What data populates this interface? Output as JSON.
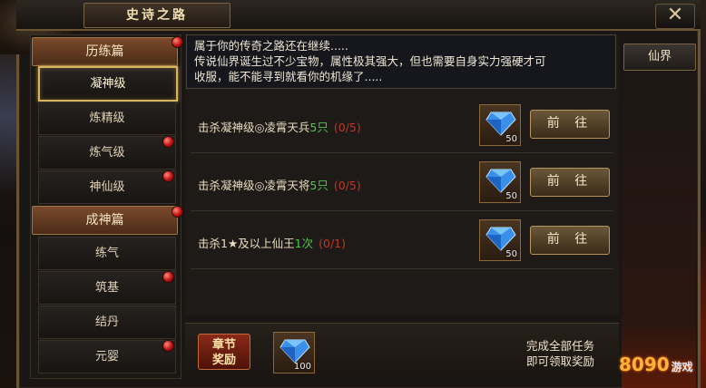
{
  "window": {
    "title": "史诗之路",
    "close_label": "✕"
  },
  "sidebar": {
    "sections": [
      {
        "label": "历练篇",
        "items": [
          "凝神级",
          "炼精级",
          "炼气级",
          "神仙级"
        ]
      },
      {
        "label": "成神篇",
        "items": [
          "练气",
          "筑基",
          "结丹",
          "元婴"
        ]
      }
    ],
    "active_item": "凝神级"
  },
  "description": {
    "line1": "属于你的传奇之路还在继续.....",
    "line2": "传说仙界诞生过不少宝物，属性极其强大，但也需要自身实力强硬才可",
    "line3": "收服，能不能寻到就看你的机缘了....."
  },
  "tasks": [
    {
      "prefix": "击杀凝神级◎凌霄天兵",
      "count": "5只",
      "progress": "(0/5)",
      "reward_count": "50",
      "button": "前 往"
    },
    {
      "prefix": "击杀凝神级◎凌霄天将",
      "count": "5只",
      "progress": "(0/5)",
      "reward_count": "50",
      "button": "前 往"
    },
    {
      "prefix": "击杀1★及以上仙王",
      "count": "1次",
      "progress": "(0/1)",
      "reward_count": "50",
      "button": "前 往"
    }
  ],
  "chapter_reward": {
    "label_line1": "章节",
    "label_line2": "奖励",
    "reward_count": "100",
    "note_line1": "完成全部任务",
    "note_line2": "即可领取奖励"
  },
  "right_tab": {
    "label": "仙界"
  },
  "watermark": {
    "text": "8090",
    "sub": "游戏"
  },
  "icons": {
    "reward": "blue-diamond-icon",
    "notification": "red-dot-icon",
    "close": "close-x-icon"
  },
  "colors": {
    "highlight_green": "#4ec64c",
    "progress_red": "#c0382a",
    "active_gold": "#d8b460"
  }
}
